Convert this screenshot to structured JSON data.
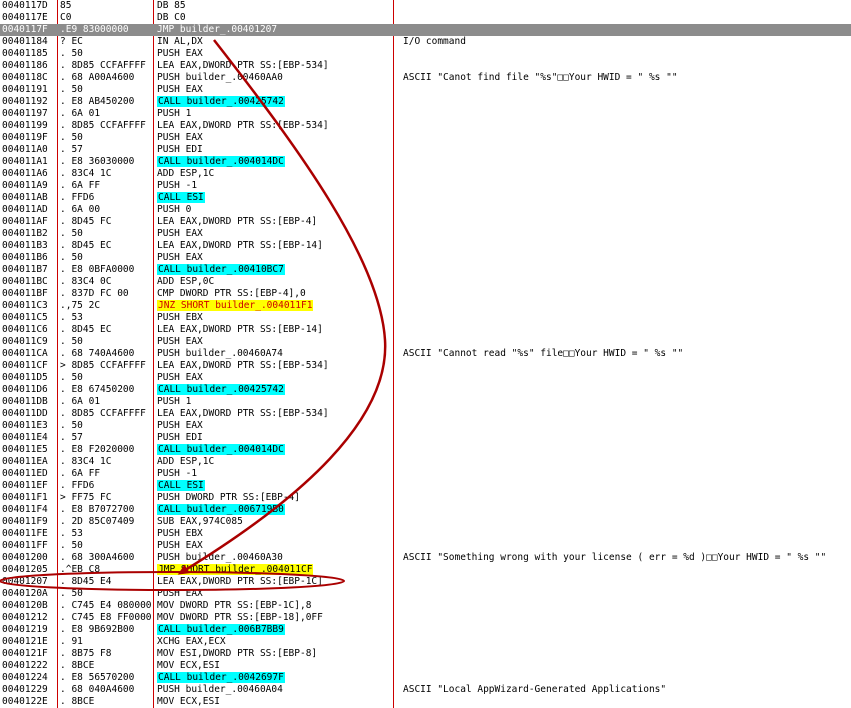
{
  "colors": {
    "call_highlight": "#00ffff",
    "jump_highlight": "#ffff00",
    "column_divider": "#cc0000",
    "selection": "#8c8c8c",
    "annotation": "#aa0000"
  },
  "rows": [
    {
      "addr": "0040117D",
      "hex": "85",
      "dis": "DB 85",
      "cmt": "",
      "hl": ""
    },
    {
      "addr": "0040117E",
      "hex": "C0",
      "dis": "DB C0",
      "cmt": "",
      "hl": ""
    },
    {
      "addr": "0040117F",
      "hex": ".E9 83000000",
      "dis": "JMP builder_.00401207",
      "cmt": "",
      "hl": "",
      "sel": true
    },
    {
      "addr": "00401184",
      "hex": "? EC",
      "dis": "IN AL,DX",
      "cmt": "I/O command",
      "hl": ""
    },
    {
      "addr": "00401185",
      "hex": ". 50",
      "dis": "PUSH EAX",
      "cmt": "",
      "hl": ""
    },
    {
      "addr": "00401186",
      "hex": ". 8D85 CCFAFFFF",
      "dis": "LEA EAX,DWORD PTR SS:[EBP-534]",
      "cmt": "",
      "hl": ""
    },
    {
      "addr": "0040118C",
      "hex": ". 68 A00A4600",
      "dis": "PUSH builder_.00460AA0",
      "cmt": "ASCII \"Canot find file \"%s\"□□Your HWID = \" %s \"\"",
      "hl": ""
    },
    {
      "addr": "00401191",
      "hex": ". 50",
      "dis": "PUSH EAX",
      "cmt": "",
      "hl": ""
    },
    {
      "addr": "00401192",
      "hex": ". E8 AB450200",
      "dis": "CALL builder_.00425742",
      "cmt": "",
      "hl": "call"
    },
    {
      "addr": "00401197",
      "hex": ". 6A 01",
      "dis": "PUSH 1",
      "cmt": "",
      "hl": ""
    },
    {
      "addr": "00401199",
      "hex": ". 8D85 CCFAFFFF",
      "dis": "LEA EAX,DWORD PTR SS:[EBP-534]",
      "cmt": "",
      "hl": ""
    },
    {
      "addr": "0040119F",
      "hex": ". 50",
      "dis": "PUSH EAX",
      "cmt": "",
      "hl": ""
    },
    {
      "addr": "004011A0",
      "hex": ". 57",
      "dis": "PUSH EDI",
      "cmt": "",
      "hl": ""
    },
    {
      "addr": "004011A1",
      "hex": ". E8 36030000",
      "dis": "CALL builder_.004014DC",
      "cmt": "",
      "hl": "call"
    },
    {
      "addr": "004011A6",
      "hex": ". 83C4 1C",
      "dis": "ADD ESP,1C",
      "cmt": "",
      "hl": ""
    },
    {
      "addr": "004011A9",
      "hex": ". 6A FF",
      "dis": "PUSH -1",
      "cmt": "",
      "hl": ""
    },
    {
      "addr": "004011AB",
      "hex": ". FFD6",
      "dis": "CALL ESI",
      "cmt": "",
      "hl": "call"
    },
    {
      "addr": "004011AD",
      "hex": ". 6A 00",
      "dis": "PUSH 0",
      "cmt": "",
      "hl": ""
    },
    {
      "addr": "004011AF",
      "hex": ". 8D45 FC",
      "dis": "LEA EAX,DWORD PTR SS:[EBP-4]",
      "cmt": "",
      "hl": ""
    },
    {
      "addr": "004011B2",
      "hex": ". 50",
      "dis": "PUSH EAX",
      "cmt": "",
      "hl": ""
    },
    {
      "addr": "004011B3",
      "hex": ". 8D45 EC",
      "dis": "LEA EAX,DWORD PTR SS:[EBP-14]",
      "cmt": "",
      "hl": ""
    },
    {
      "addr": "004011B6",
      "hex": ". 50",
      "dis": "PUSH EAX",
      "cmt": "",
      "hl": ""
    },
    {
      "addr": "004011B7",
      "hex": ". E8 0BFA0000",
      "dis": "CALL builder_.00410BC7",
      "cmt": "",
      "hl": "call"
    },
    {
      "addr": "004011BC",
      "hex": ". 83C4 0C",
      "dis": "ADD ESP,0C",
      "cmt": "",
      "hl": ""
    },
    {
      "addr": "004011BF",
      "hex": ". 837D FC 00",
      "dis": "CMP DWORD PTR SS:[EBP-4],0",
      "cmt": "",
      "hl": ""
    },
    {
      "addr": "004011C3",
      "hex": ".,75 2C",
      "dis": "JNZ SHORT builder_.004011F1",
      "cmt": "",
      "hl": "jnz"
    },
    {
      "addr": "004011C5",
      "hex": ". 53",
      "dis": "PUSH EBX",
      "cmt": "",
      "hl": ""
    },
    {
      "addr": "004011C6",
      "hex": ". 8D45 EC",
      "dis": "LEA EAX,DWORD PTR SS:[EBP-14]",
      "cmt": "",
      "hl": ""
    },
    {
      "addr": "004011C9",
      "hex": ". 50",
      "dis": "PUSH EAX",
      "cmt": "",
      "hl": ""
    },
    {
      "addr": "004011CA",
      "hex": ". 68 740A4600",
      "dis": "PUSH builder_.00460A74",
      "cmt": "ASCII \"Cannot read \"%s\" file□□Your HWID = \" %s \"\"",
      "hl": ""
    },
    {
      "addr": "004011CF",
      "hex": "> 8D85 CCFAFFFF",
      "dis": "LEA EAX,DWORD PTR SS:[EBP-534]",
      "cmt": "",
      "hl": ""
    },
    {
      "addr": "004011D5",
      "hex": ". 50",
      "dis": "PUSH EAX",
      "cmt": "",
      "hl": ""
    },
    {
      "addr": "004011D6",
      "hex": ". E8 67450200",
      "dis": "CALL builder_.00425742",
      "cmt": "",
      "hl": "call"
    },
    {
      "addr": "004011DB",
      "hex": ". 6A 01",
      "dis": "PUSH 1",
      "cmt": "",
      "hl": ""
    },
    {
      "addr": "004011DD",
      "hex": ". 8D85 CCFAFFFF",
      "dis": "LEA EAX,DWORD PTR SS:[EBP-534]",
      "cmt": "",
      "hl": ""
    },
    {
      "addr": "004011E3",
      "hex": ". 50",
      "dis": "PUSH EAX",
      "cmt": "",
      "hl": ""
    },
    {
      "addr": "004011E4",
      "hex": ". 57",
      "dis": "PUSH EDI",
      "cmt": "",
      "hl": ""
    },
    {
      "addr": "004011E5",
      "hex": ". E8 F2020000",
      "dis": "CALL builder_.004014DC",
      "cmt": "",
      "hl": "call"
    },
    {
      "addr": "004011EA",
      "hex": ". 83C4 1C",
      "dis": "ADD ESP,1C",
      "cmt": "",
      "hl": ""
    },
    {
      "addr": "004011ED",
      "hex": ". 6A FF",
      "dis": "PUSH -1",
      "cmt": "",
      "hl": ""
    },
    {
      "addr": "004011EF",
      "hex": ". FFD6",
      "dis": "CALL ESI",
      "cmt": "",
      "hl": "call"
    },
    {
      "addr": "004011F1",
      "hex": "> FF75 FC",
      "dis": "PUSH DWORD PTR SS:[EBP-4]",
      "cmt": "",
      "hl": ""
    },
    {
      "addr": "004011F4",
      "hex": ". E8 B7072700",
      "dis": "CALL builder_.006719B0",
      "cmt": "",
      "hl": "call"
    },
    {
      "addr": "004011F9",
      "hex": ". 2D 85C07409",
      "dis": "SUB EAX,974C085",
      "cmt": "",
      "hl": ""
    },
    {
      "addr": "004011FE",
      "hex": ". 53",
      "dis": "PUSH EBX",
      "cmt": "",
      "hl": ""
    },
    {
      "addr": "004011FF",
      "hex": ". 50",
      "dis": "PUSH EAX",
      "cmt": "",
      "hl": ""
    },
    {
      "addr": "00401200",
      "hex": ". 68 300A4600",
      "dis": "PUSH builder_.00460A30",
      "cmt": "ASCII \"Something wrong with your license ( err = %d )□□Your HWID = \" %s \"\"",
      "hl": ""
    },
    {
      "addr": "00401205",
      "hex": ".^EB C8",
      "dis": "JMP SHORT builder_.004011CF",
      "cmt": "",
      "hl": "jmp"
    },
    {
      "addr": "00401207",
      "hex": ". 8D45 E4",
      "dis": "LEA EAX,DWORD PTR SS:[EBP-1C]",
      "cmt": "",
      "hl": ""
    },
    {
      "addr": "0040120A",
      "hex": ". 50",
      "dis": "PUSH EAX",
      "cmt": "",
      "hl": ""
    },
    {
      "addr": "0040120B",
      "hex": ". C745 E4 080000",
      "dis": "MOV DWORD PTR SS:[EBP-1C],8",
      "cmt": "",
      "hl": ""
    },
    {
      "addr": "00401212",
      "hex": ". C745 E8 FF0000",
      "dis": "MOV DWORD PTR SS:[EBP-18],0FF",
      "cmt": "",
      "hl": ""
    },
    {
      "addr": "00401219",
      "hex": ". E8 9B692B00",
      "dis": "CALL builder_.006B7BB9",
      "cmt": "",
      "hl": "call"
    },
    {
      "addr": "0040121E",
      "hex": ". 91",
      "dis": "XCHG EAX,ECX",
      "cmt": "",
      "hl": ""
    },
    {
      "addr": "0040121F",
      "hex": ". 8B75 F8",
      "dis": "MOV ESI,DWORD PTR SS:[EBP-8]",
      "cmt": "",
      "hl": ""
    },
    {
      "addr": "00401222",
      "hex": ". 8BCE",
      "dis": "MOV ECX,ESI",
      "cmt": "",
      "hl": ""
    },
    {
      "addr": "00401224",
      "hex": ". E8 56570200",
      "dis": "CALL builder_.0042697F",
      "cmt": "",
      "hl": "call"
    },
    {
      "addr": "00401229",
      "hex": ". 68 040A4600",
      "dis": "PUSH builder_.00460A04",
      "cmt": "ASCII \"Local AppWizard-Generated Applications\"",
      "hl": ""
    },
    {
      "addr": "0040122E",
      "hex": ". 8BCE",
      "dis": "MOV ECX,ESI",
      "cmt": "",
      "hl": ""
    }
  ]
}
